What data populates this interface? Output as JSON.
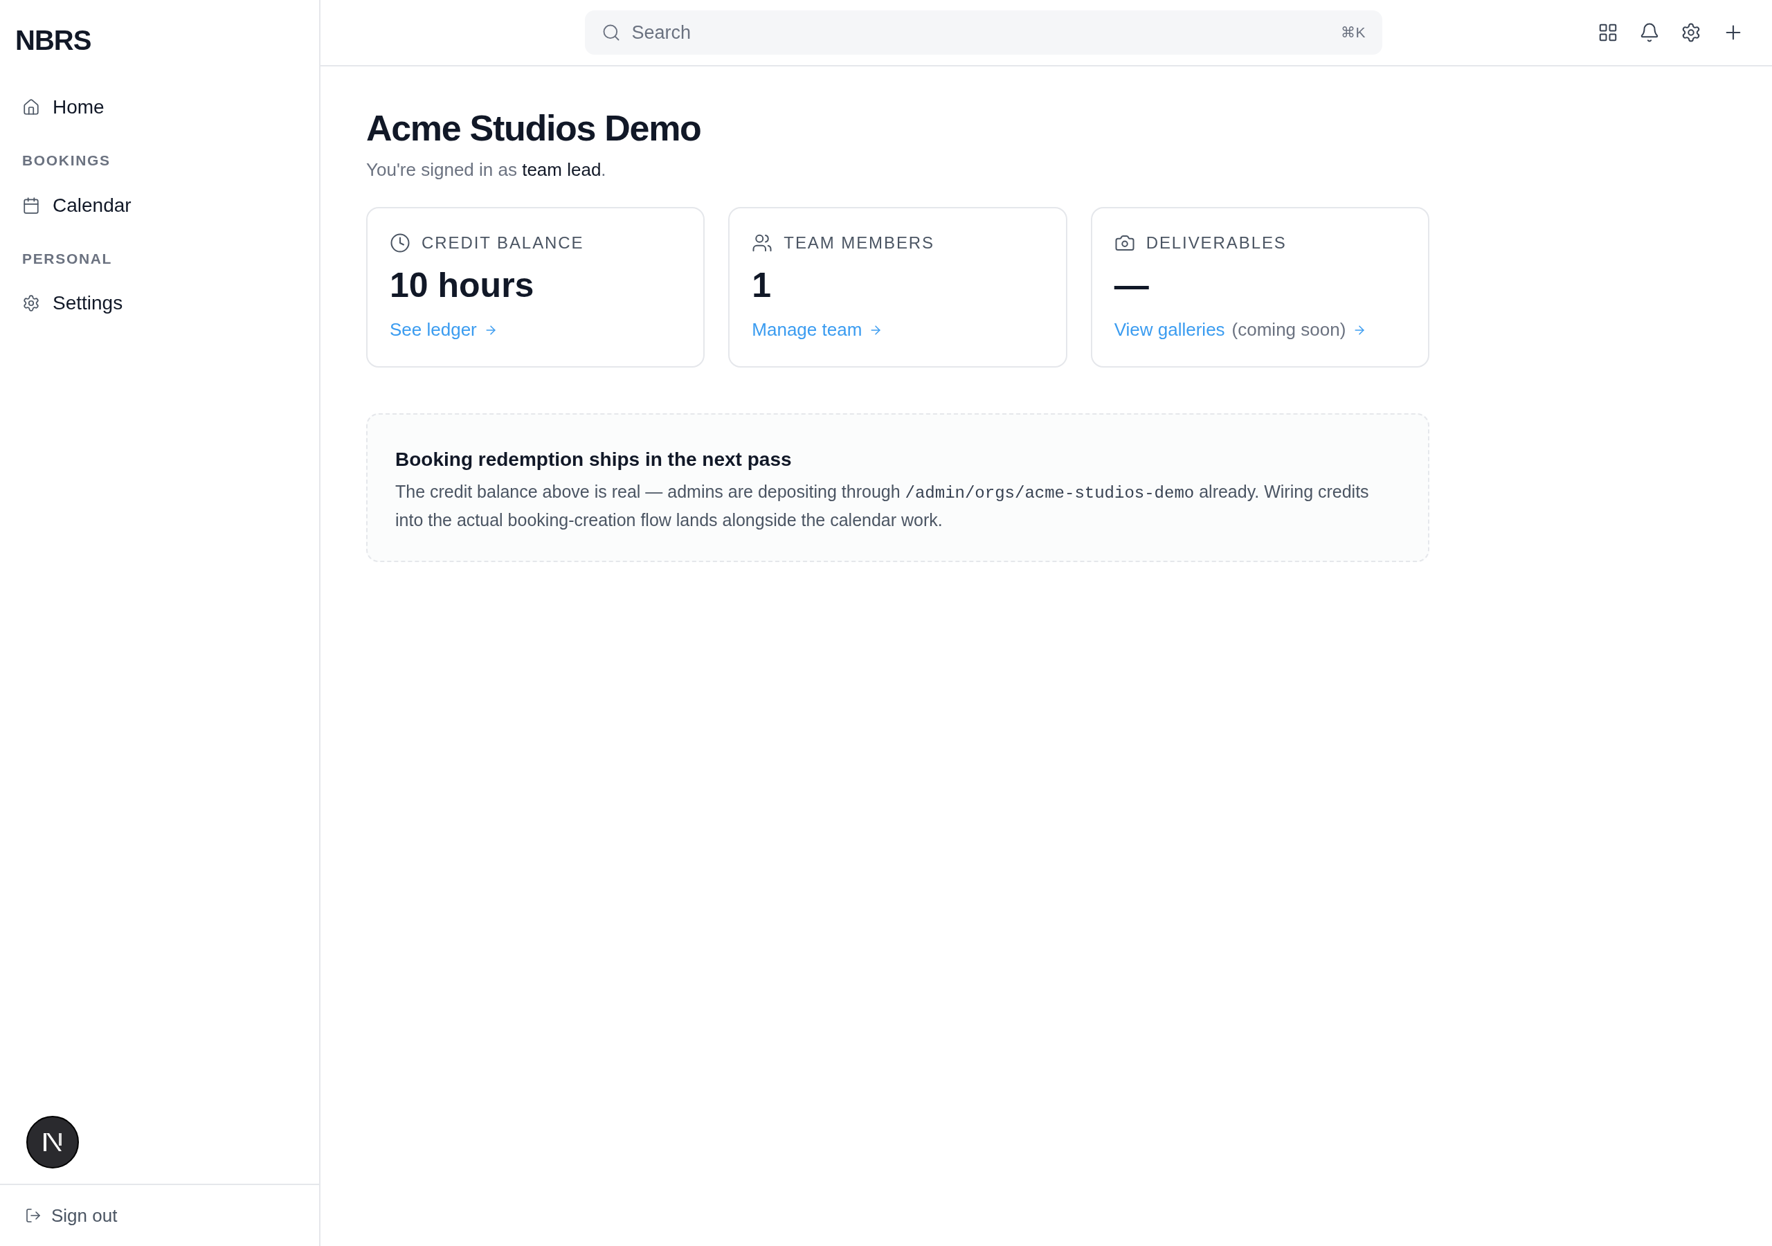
{
  "sidebar": {
    "logo": "NBRS",
    "sections": [
      {
        "items": [
          {
            "kind": "home",
            "label": "Home"
          }
        ]
      },
      {
        "heading": "BOOKINGS",
        "items": [
          {
            "kind": "calendar",
            "label": "Calendar"
          }
        ]
      },
      {
        "heading": "PERSONAL",
        "items": [
          {
            "kind": "settings",
            "label": "Settings"
          }
        ]
      }
    ],
    "sign_out": "Sign out"
  },
  "header": {
    "search": {
      "placeholder": "Search",
      "shortcut": "⌘K"
    }
  },
  "page": {
    "title": "Acme Studios Demo",
    "subtitle": "You're signed in as **team lead**.",
    "cards": [
      {
        "kind": "clock",
        "label": "CREDIT BALANCE",
        "value": "10 hours",
        "link": "See ledger"
      },
      {
        "kind": "people",
        "label": "TEAM MEMBERS",
        "value": "1",
        "link": "Manage team"
      },
      {
        "kind": "camera",
        "label": "DELIVERABLES",
        "value": "—",
        "link": "View galleries",
        "note": "(coming soon)"
      }
    ],
    "notice": {
      "title": "Booking redemption ships in the next pass",
      "text_before": "The credit balance above is real — admins are depositing through",
      "code": "/admin/orgs/acme-studios-demo",
      "text_after": "already. Wiring credits into the actual booking-creation flow lands alongside the calendar work."
    }
  }
}
